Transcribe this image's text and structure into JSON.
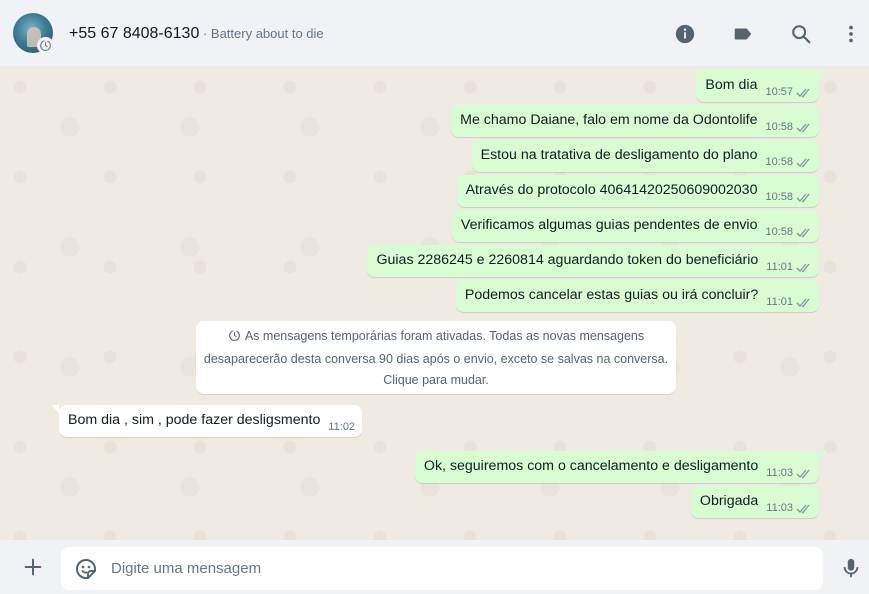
{
  "header": {
    "contact_name": "+55 67 8408-6130",
    "contact_status": " · Battery about to die",
    "icons": [
      "info-icon",
      "label-icon",
      "search-icon",
      "menu-icon"
    ]
  },
  "messages": [
    {
      "direction": "out",
      "text": "Bom dia",
      "time": "10:57",
      "status": "delivered"
    },
    {
      "direction": "out",
      "text": "Me chamo Daiane, falo em nome da Odontolife",
      "time": "10:58",
      "status": "delivered"
    },
    {
      "direction": "out",
      "text": "Estou na tratativa de desligamento do plano",
      "time": "10:58",
      "status": "delivered"
    },
    {
      "direction": "out",
      "text": "Através do protocolo 40641420250609002030",
      "time": "10:58",
      "status": "delivered"
    },
    {
      "direction": "out",
      "text": "Verificamos algumas guias pendentes de envio",
      "time": "10:58",
      "status": "delivered"
    },
    {
      "direction": "out",
      "text": "Guias 2286245 e 2260814 aguardando token do beneficiário",
      "time": "11:01",
      "status": "delivered"
    },
    {
      "direction": "out",
      "text": "Podemos cancelar estas guias ou irá concluir?",
      "time": "11:01",
      "status": "delivered"
    },
    {
      "direction": "in",
      "text": "Bom dia , sim , pode fazer desligsmento",
      "time": "11:02"
    },
    {
      "direction": "out",
      "text": "Ok, seguiremos com o cancelamento e desligamento",
      "time": "11:03",
      "status": "delivered"
    },
    {
      "direction": "out",
      "text": "Obrigada",
      "time": "11:03",
      "status": "delivered"
    }
  ],
  "system_notice": {
    "line1": "As mensagens temporárias foram ativadas. Todas as novas mensagens",
    "line2": "desaparecerão desta conversa 90 dias após o envio, exceto se salvas na conversa.",
    "line3": "Clique para mudar."
  },
  "composer": {
    "placeholder": "Digite uma mensagem",
    "icons": [
      "plus-icon",
      "sticker-icon",
      "microphone-icon"
    ]
  },
  "colors": {
    "outgoing_bubble": "#d9fdd3",
    "incoming_bubble": "#ffffff",
    "chat_background": "#efeae2",
    "bar_background": "#f0f2f5"
  }
}
